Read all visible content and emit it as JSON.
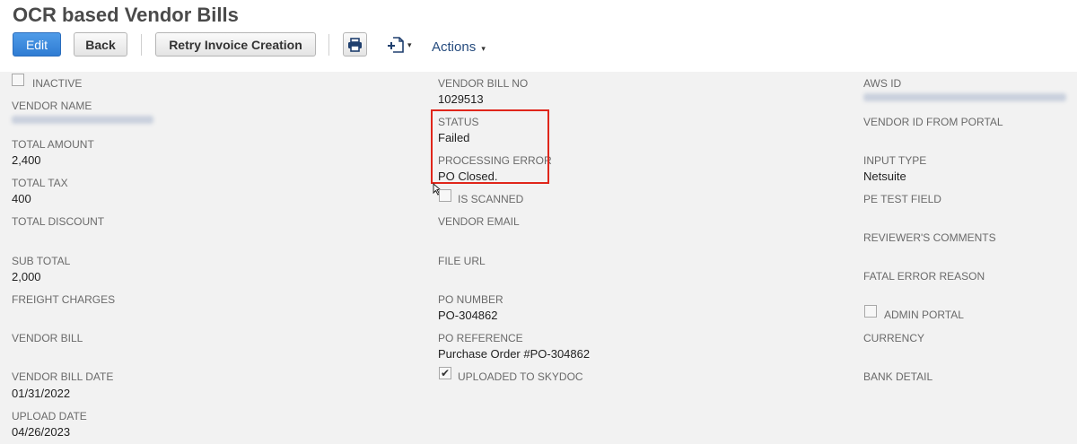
{
  "page": {
    "title": "OCR based Vendor Bills"
  },
  "toolbar": {
    "edit_label": "Edit",
    "back_label": "Back",
    "retry_label": "Retry Invoice Creation",
    "actions_label": "Actions",
    "caret": "▾"
  },
  "fields": {
    "inactive": {
      "label": "INACTIVE",
      "checked": false
    },
    "vendor_name": {
      "label": "VENDOR NAME"
    },
    "total_amount": {
      "label": "TOTAL AMOUNT",
      "value": "2,400"
    },
    "total_tax": {
      "label": "TOTAL TAX",
      "value": "400"
    },
    "total_discount": {
      "label": "TOTAL DISCOUNT"
    },
    "sub_total": {
      "label": "SUB TOTAL",
      "value": "2,000"
    },
    "freight_charges": {
      "label": "FREIGHT CHARGES"
    },
    "vendor_bill": {
      "label": "VENDOR BILL"
    },
    "vendor_bill_date": {
      "label": "VENDOR BILL DATE",
      "value": "01/31/2022"
    },
    "upload_date": {
      "label": "UPLOAD DATE",
      "value": "04/26/2023"
    },
    "vendor_bill_no": {
      "label": "VENDOR BILL NO",
      "value": "1029513"
    },
    "status": {
      "label": "STATUS",
      "value": "Failed"
    },
    "processing_error": {
      "label": "PROCESSING ERROR",
      "value": "PO Closed."
    },
    "is_scanned": {
      "label": "IS SCANNED",
      "checked": false
    },
    "vendor_email": {
      "label": "VENDOR EMAIL"
    },
    "file_url": {
      "label": "FILE URL"
    },
    "po_number": {
      "label": "PO NUMBER",
      "value": "PO-304862"
    },
    "po_reference": {
      "label": "PO REFERENCE",
      "value": "Purchase Order #PO-304862"
    },
    "uploaded_to_skydoc": {
      "label": "UPLOADED TO SKYDOC",
      "checked": true,
      "check_glyph": "✔"
    },
    "aws_id": {
      "label": "AWS ID"
    },
    "vendor_id_from_portal": {
      "label": "VENDOR ID FROM PORTAL"
    },
    "input_type": {
      "label": "INPUT TYPE",
      "value": "Netsuite"
    },
    "pe_test_field": {
      "label": "PE TEST FIELD"
    },
    "reviewers_comments": {
      "label": "REVIEWER'S COMMENTS"
    },
    "fatal_error_reason": {
      "label": "FATAL ERROR REASON"
    },
    "admin_portal": {
      "label": "ADMIN PORTAL",
      "checked": false
    },
    "currency": {
      "label": "CURRENCY"
    },
    "bank_detail": {
      "label": "BANK DETAIL"
    }
  },
  "colors": {
    "primary_button": "#2f7cd3",
    "highlight_box": "#e0261b",
    "actions_link": "#254b7e",
    "body_background": "#f2f2f2"
  },
  "icons": {
    "print": "printer-icon",
    "new_record": "new-record-icon",
    "cursor": "mouse-cursor-icon"
  }
}
